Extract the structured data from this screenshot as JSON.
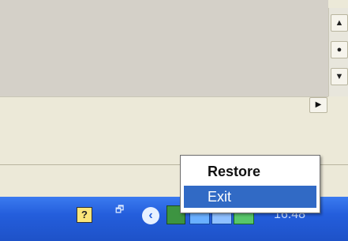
{
  "menu": {
    "items": [
      {
        "label": "Restore",
        "default": true,
        "selected": false
      },
      {
        "label": "Exit",
        "default": false,
        "selected": true
      }
    ]
  },
  "taskbar": {
    "clock": "16:48",
    "tray_icons": [
      "help-icon",
      "restore-window-icon",
      "show-hidden-icons-chevron-icon",
      "network-icon",
      "audio-icon",
      "monitor-icon",
      "network-status-icon"
    ]
  },
  "scrollbars": {
    "vertical_buttons": [
      "▲",
      "●",
      "▼"
    ],
    "horizontal_right": "▶"
  }
}
